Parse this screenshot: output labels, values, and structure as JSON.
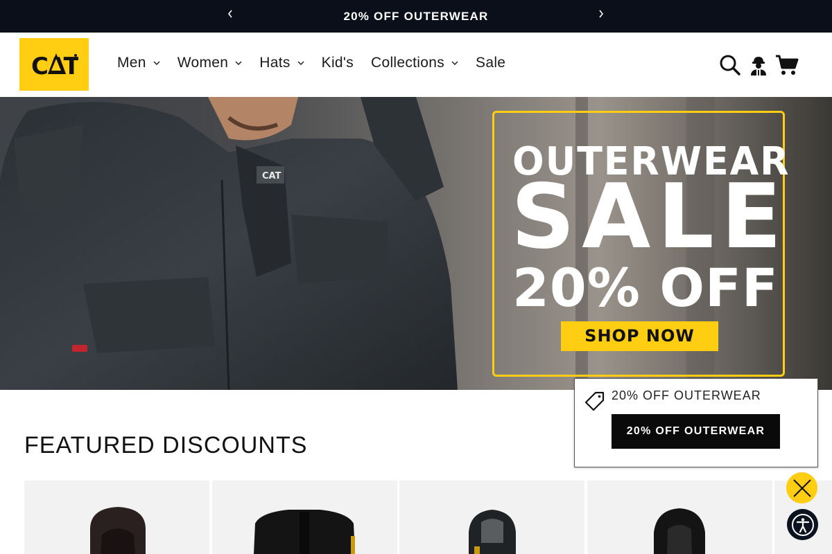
{
  "announcement": {
    "text": "20% OFF OUTERWEAR",
    "prev_icon": "chevron-left-icon",
    "next_icon": "chevron-right-icon"
  },
  "header": {
    "logo_text": "CAT",
    "nav": [
      {
        "label": "Men",
        "has_dropdown": true
      },
      {
        "label": "Women",
        "has_dropdown": true
      },
      {
        "label": "Hats",
        "has_dropdown": true
      },
      {
        "label": "Kid's",
        "has_dropdown": false
      },
      {
        "label": "Collections",
        "has_dropdown": true
      },
      {
        "label": "Sale",
        "has_dropdown": false
      }
    ],
    "icons": [
      "search-icon",
      "account-worker-icon",
      "cart-icon"
    ]
  },
  "hero": {
    "line1": "OUTERWEAR",
    "line2": "SALE",
    "line3": "20% OFF",
    "cta": "SHOP NOW",
    "accent": "#ffcd11"
  },
  "featured": {
    "title": "FEATURED DISCOUNTS",
    "product_count_visible": 5
  },
  "popup": {
    "text": "20% OFF OUTERWEAR",
    "button": "20% OFF OUTERWEAR",
    "icon": "tag-icon"
  },
  "floating": {
    "close_icon": "close-icon",
    "accessibility_icon": "accessibility-icon"
  },
  "colors": {
    "brand_yellow": "#ffcd11",
    "announcement_bg": "#0b0f1a",
    "button_black": "#0a0a0a"
  }
}
